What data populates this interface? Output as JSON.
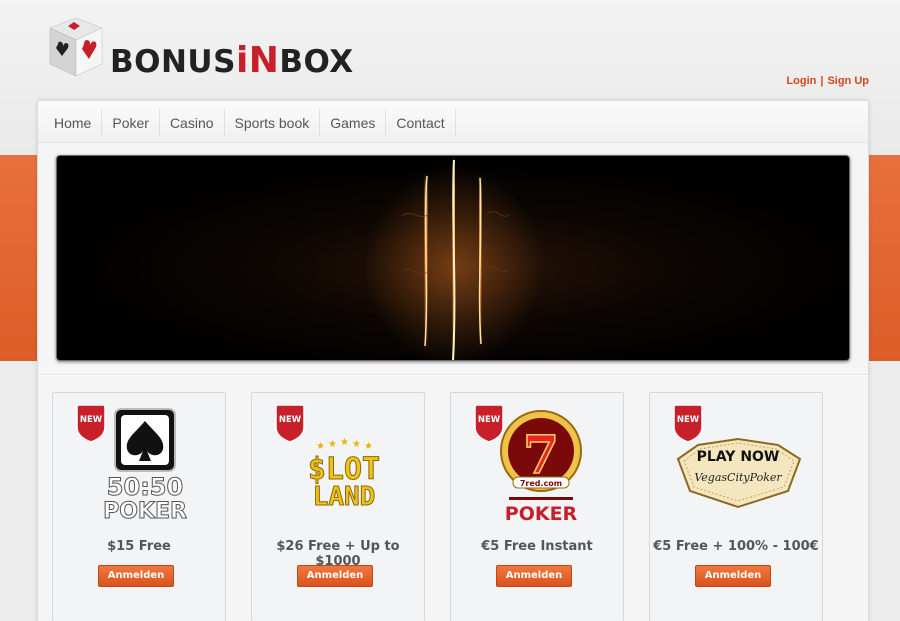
{
  "brand": {
    "name_prefix": "BONUS",
    "name_accent": "iN",
    "name_suffix": "BOX"
  },
  "auth": {
    "login": "Login",
    "separator": "|",
    "signup": "Sign Up"
  },
  "nav": {
    "items": [
      {
        "label": "Home"
      },
      {
        "label": "Poker"
      },
      {
        "label": "Casino"
      },
      {
        "label": "Sports book"
      },
      {
        "label": "Games"
      },
      {
        "label": "Contact"
      }
    ]
  },
  "cards": [
    {
      "badge": "NEW",
      "logo_lines": [
        "50:50",
        "POKER"
      ],
      "offer": "$15 Free",
      "button": "Anmelden",
      "icon": "spade-icon"
    },
    {
      "badge": "NEW",
      "logo_lines": [
        "$LOT",
        "LAND"
      ],
      "offer": "$26 Free + Up to $1000",
      "button": "Anmelden",
      "icon": "stars-icon"
    },
    {
      "badge": "NEW",
      "logo_lines": [
        "7red.com",
        "POKER"
      ],
      "offer": "€5 Free Instant",
      "button": "Anmelden",
      "icon": "seven-icon"
    },
    {
      "badge": "NEW",
      "logo_lines": [
        "PLAY NOW",
        "VegasCityPoker"
      ],
      "offer": "€5 Free + 100% - 100€",
      "button": "Anmelden",
      "icon": "vegas-sign-icon"
    }
  ],
  "colors": {
    "accent": "#dc5d28",
    "link": "#d3461a",
    "badge_red": "#c8202a"
  }
}
